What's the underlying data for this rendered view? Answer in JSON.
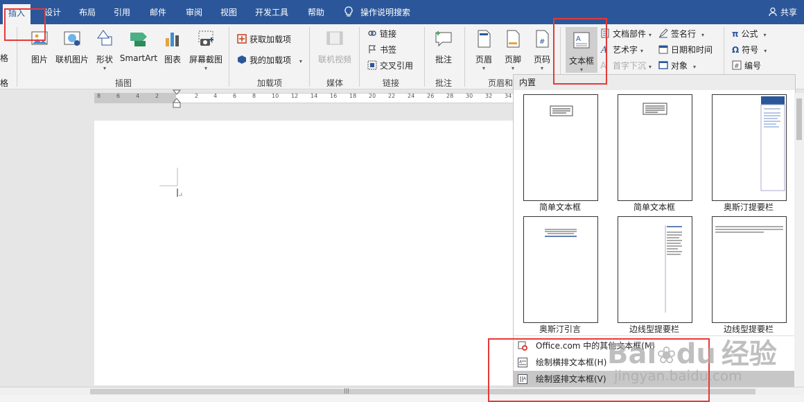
{
  "tabs": [
    {
      "label": "插入",
      "active": true
    },
    {
      "label": "设计"
    },
    {
      "label": "布局"
    },
    {
      "label": "引用"
    },
    {
      "label": "邮件"
    },
    {
      "label": "审阅"
    },
    {
      "label": "视图"
    },
    {
      "label": "开发工具"
    },
    {
      "label": "帮助"
    }
  ],
  "search_label": "操作说明搜索",
  "share_label": "共享",
  "ribbon": {
    "edge_labels": [
      "格",
      "格"
    ],
    "illustrations": {
      "picture": "图片",
      "online_picture": "联机图片",
      "shapes": "形状",
      "smartart": "SmartArt",
      "chart": "图表",
      "screenshot": "屏幕截图",
      "label": "插图"
    },
    "addins": {
      "get": "获取加载项",
      "my": "我的加载项",
      "label": "加载项"
    },
    "media": {
      "online_video": "联机视频",
      "label": "媒体"
    },
    "links": {
      "link": "链接",
      "bookmark": "书签",
      "cross_ref": "交叉引用",
      "label": "链接"
    },
    "comments": {
      "comment": "批注",
      "label": "批注"
    },
    "header_footer": {
      "header": "页眉",
      "footer": "页脚",
      "page_number": "页码",
      "label": "页眉和"
    },
    "text": {
      "textbox": "文本框",
      "quick_parts": "文档部件",
      "wordart": "艺术字",
      "dropcap": "首字下沉",
      "signature": "签名行",
      "datetime": "日期和时间",
      "object": "对象"
    },
    "symbols": {
      "equation": "公式",
      "symbol": "符号",
      "number": "编号"
    }
  },
  "ruler_ticks": [
    "8",
    "6",
    "4",
    "2",
    "2",
    "4",
    "6",
    "8",
    "10",
    "12",
    "14",
    "16",
    "18",
    "20",
    "22",
    "24",
    "26",
    "28",
    "30",
    "32",
    "34"
  ],
  "gallery": {
    "header": "内置",
    "items": [
      {
        "caption": "简单文本框"
      },
      {
        "caption": "简单文本框"
      },
      {
        "caption": "奥斯汀提要栏"
      },
      {
        "caption": "奥斯汀引言"
      },
      {
        "caption": "边线型提要栏"
      },
      {
        "caption": "边线型提要栏"
      }
    ],
    "menu": [
      {
        "label": "Office.com 中的其他文本框(M)"
      },
      {
        "label": "绘制横排文本框(H)"
      },
      {
        "label": "绘制竖排文本框(V)"
      }
    ]
  },
  "watermark": {
    "brand": "Bai",
    "brand2": "du",
    "site_cn": "经验",
    "url": "jingyan.baidu.com"
  },
  "colors": {
    "accent": "#2b579a",
    "highlight": "#e53935"
  }
}
